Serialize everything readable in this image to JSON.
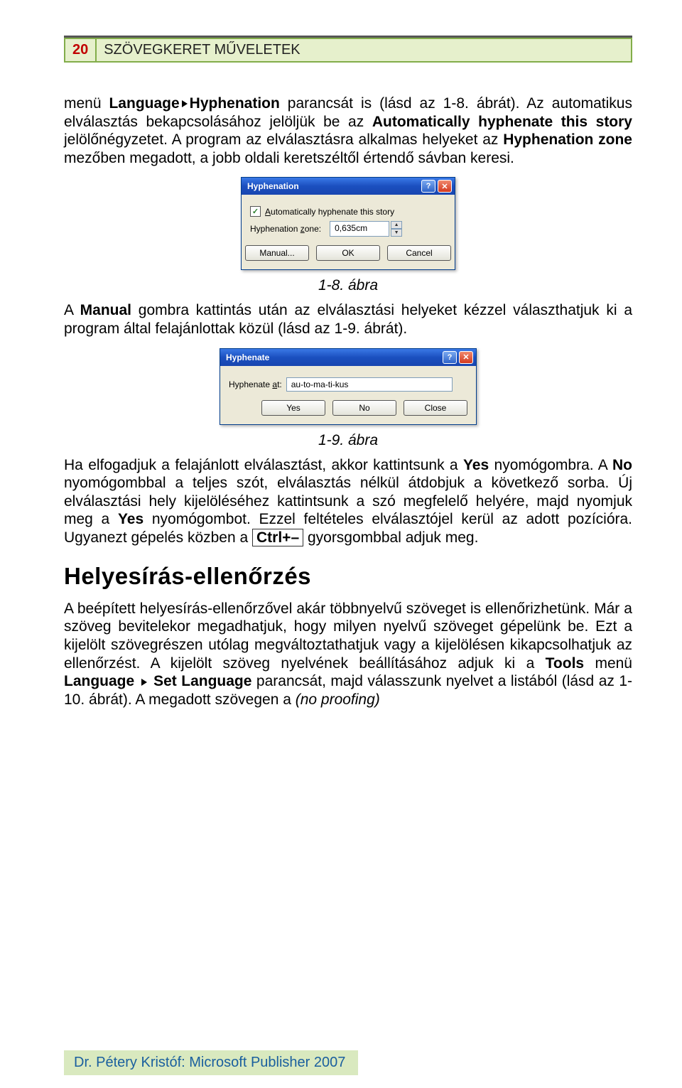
{
  "header": {
    "page_number": "20",
    "title": "SZÖVEGKERET MŰVELETEK"
  },
  "para1_a": "menü ",
  "para1_b": "Language",
  "para1_c": "Hyphenation",
  "para1_d": " parancsát is (lásd az 1-8. ábrát). Az automatikus elválasztás bekapcsolásához jelöljük be az ",
  "para1_e": "Automatically hyphenate this story",
  "para1_f": " jelölőnégyzetet. A program az elválasztásra alkalmas helyeket az ",
  "para1_g": "Hyphenation zone",
  "para1_h": " mezőben megadott, a jobb oldali keretszéltől értendő sávban keresi.",
  "dialog1": {
    "title": "Hyphenation",
    "checkbox_pre": "A",
    "checkbox_label": "utomatically hyphenate this story",
    "zone_pre": "Hyphenation ",
    "zone_ul": "z",
    "zone_post": "one:",
    "zone_value": "0,635cm",
    "btn_manual_pre": "M",
    "btn_manual": "anual...",
    "btn_ok": "OK",
    "btn_cancel": "Cancel"
  },
  "caption1": "1-8. ábra",
  "para2_a": "A ",
  "para2_b": "Manual",
  "para2_c": " gombra kattintás után az elválasztási helyeket kézzel választhatjuk ki a program által felajánlottak közül (lásd az 1-9. ábrát).",
  "dialog2": {
    "title": "Hyphenate",
    "label_pre": "Hyphenate ",
    "label_ul": "a",
    "label_post": "t:",
    "value": "au-to-ma-ti-kus",
    "btn_yes_ul": "Y",
    "btn_yes": "es",
    "btn_no_ul": "N",
    "btn_no": "o",
    "btn_close": "Close"
  },
  "caption2": "1-9. ábra",
  "para3_a": "Ha elfogadjuk a felajánlott elválasztást, akkor kattintsunk a ",
  "para3_b": "Yes",
  "para3_c": " nyomógombra. A ",
  "para3_d": "No",
  "para3_e": " nyomógombbal a teljes szót, elválasztás nélkül átdobjuk a következő sorba. Új elválasztási hely kijelöléséhez kattintsunk a szó megfelelő helyére, majd nyomjuk meg a ",
  "para3_f": "Yes",
  "para3_g": " nyomógombot. Ezzel feltételes elválasztójel kerül az adott pozícióra. Ugyanezt gépelés közben a ",
  "para3_kbd": "Ctrl+–",
  "para3_h": " gyorsgombbal adjuk meg.",
  "heading2": "Helyesírás-ellenőrzés",
  "para4_a": "A beépített helyesírás-ellenőrzővel akár többnyelvű szöveget is ellenőrizhetünk. Már a szöveg bevitelekor megadhatjuk, hogy milyen nyelvű szöveget gépelünk be. Ezt a kijelölt szövegrészen utólag megváltoztathatjuk vagy a kijelölésen kikapcsolhatjuk az ellenőrzést. A kijelölt szöveg nyelvének beállításához adjuk ki a ",
  "para4_b": "Tools",
  "para4_c": " menü ",
  "para4_d": "Language",
  "para4_e": "Set Language",
  "para4_f": " parancsát, majd válasszunk nyelvet a listából (lásd az 1-10. ábrát). A megadott szövegen a ",
  "para4_g": "(no proofing)",
  "footer": "Dr. Pétery Kristóf: Microsoft Publisher 2007"
}
